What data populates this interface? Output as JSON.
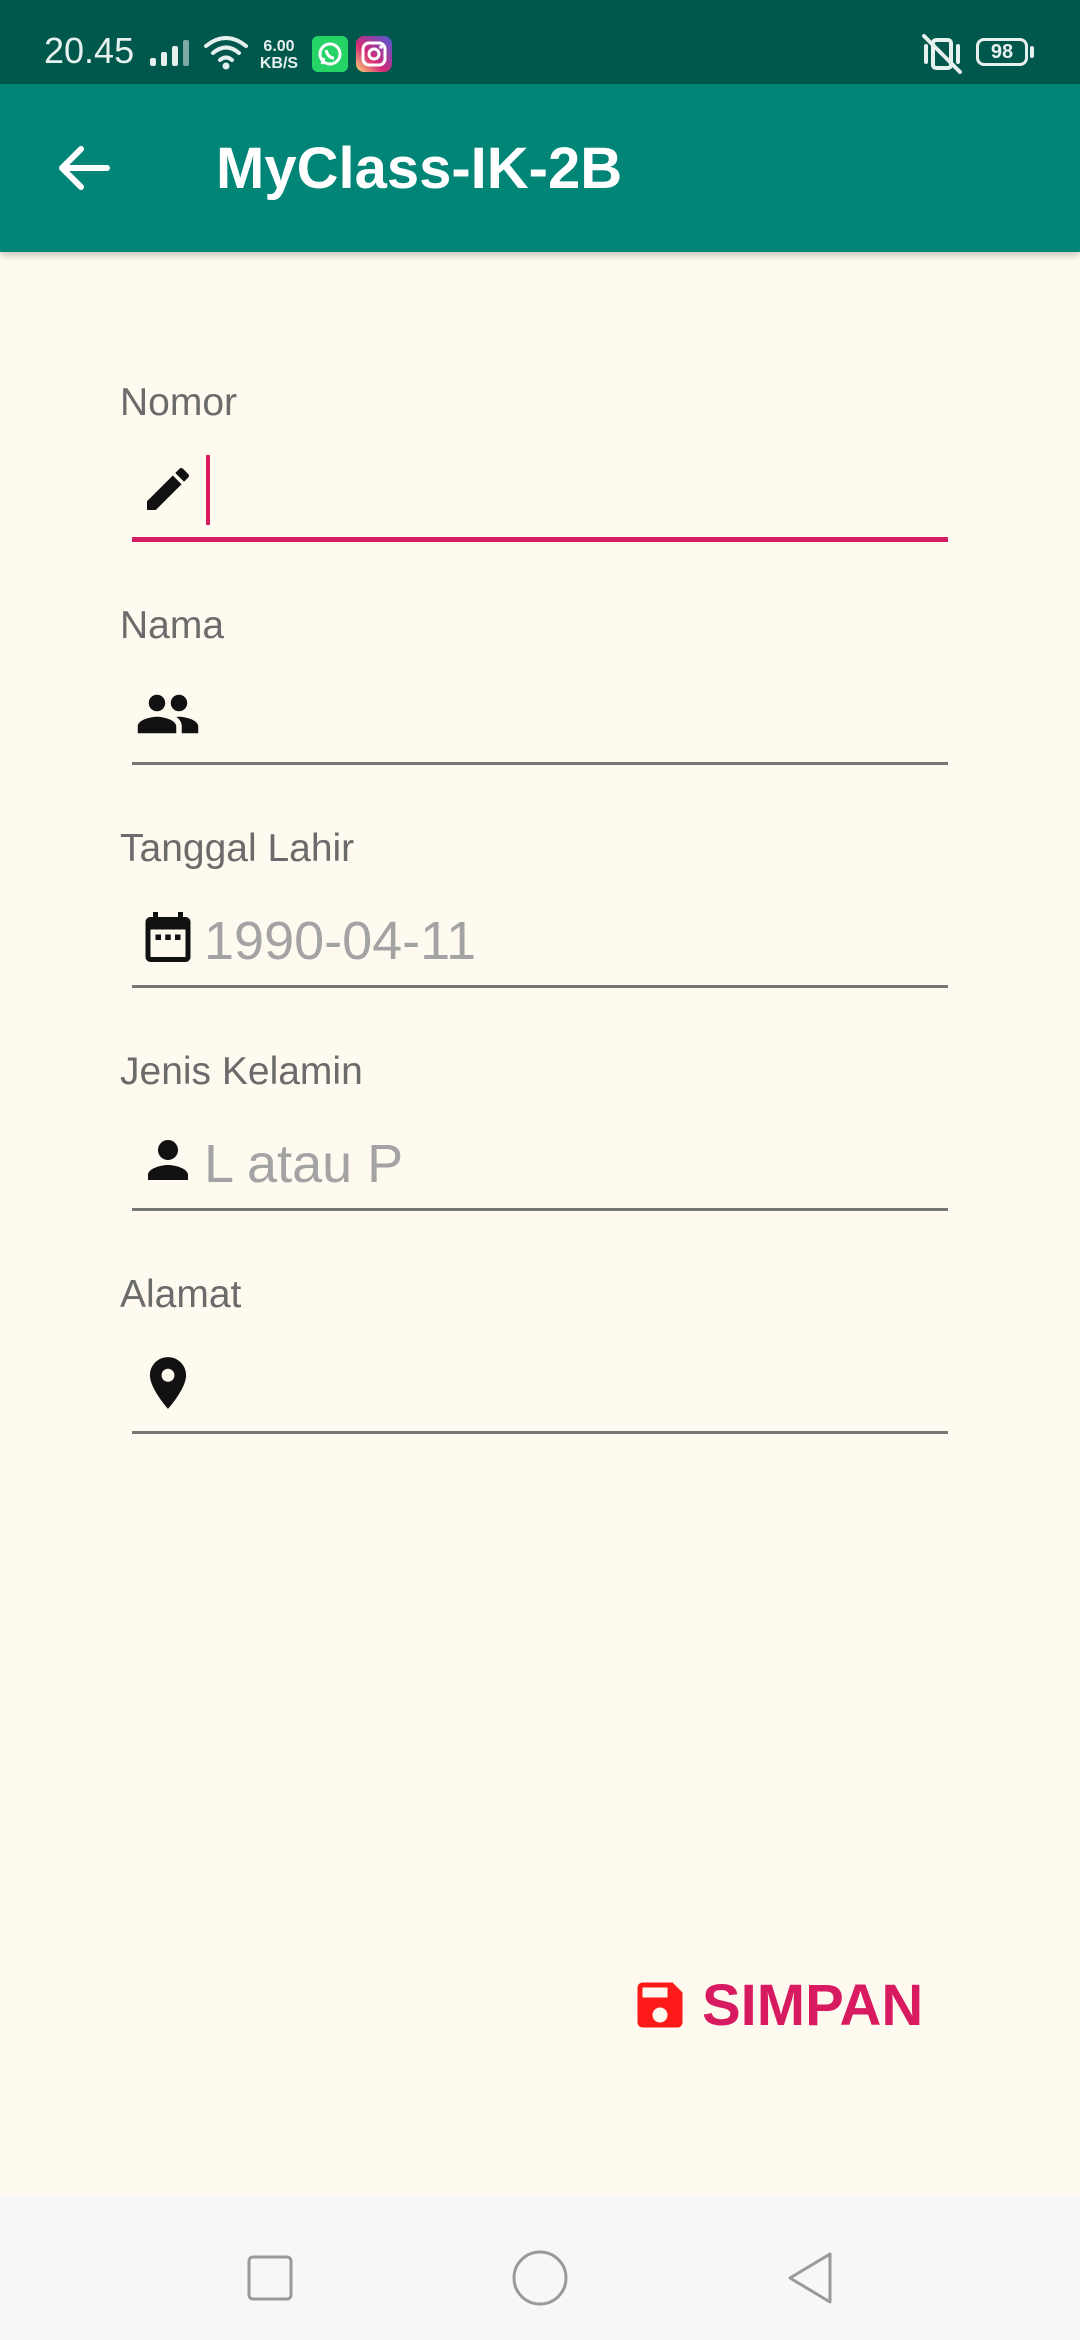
{
  "status_bar": {
    "time": "20.45",
    "net_speed_value": "6.00",
    "net_speed_unit": "KB/S",
    "battery": "98",
    "icons": [
      "signal-icon",
      "wifi-icon",
      "whatsapp-icon",
      "instagram-icon",
      "vibrate-off-icon",
      "battery-icon"
    ]
  },
  "app_bar": {
    "title": "MyClass-IK-2B",
    "back_icon": "arrow-back-icon"
  },
  "form": {
    "fields": [
      {
        "label": "Nomor",
        "icon": "pencil-icon",
        "value": "",
        "placeholder": ""
      },
      {
        "label": "Nama",
        "icon": "people-icon",
        "value": "",
        "placeholder": ""
      },
      {
        "label": "Tanggal Lahir",
        "icon": "calendar-icon",
        "value": "",
        "placeholder": "1990-04-11"
      },
      {
        "label": "Jenis Kelamin",
        "icon": "person-icon",
        "value": "",
        "placeholder": "L atau P"
      },
      {
        "label": "Alamat",
        "icon": "location-pin-icon",
        "value": "",
        "placeholder": ""
      }
    ]
  },
  "actions": {
    "save_label": "SIMPAN",
    "save_icon": "floppy-disk-icon"
  },
  "colors": {
    "status_bar": "#00574b",
    "app_bar": "#008577",
    "background": "#fefaef",
    "accent": "#d81b60",
    "save_icon": "#ff1a1a"
  },
  "nav_bar": {
    "buttons": [
      "recent-apps-icon",
      "home-icon",
      "back-triangle-icon"
    ]
  }
}
